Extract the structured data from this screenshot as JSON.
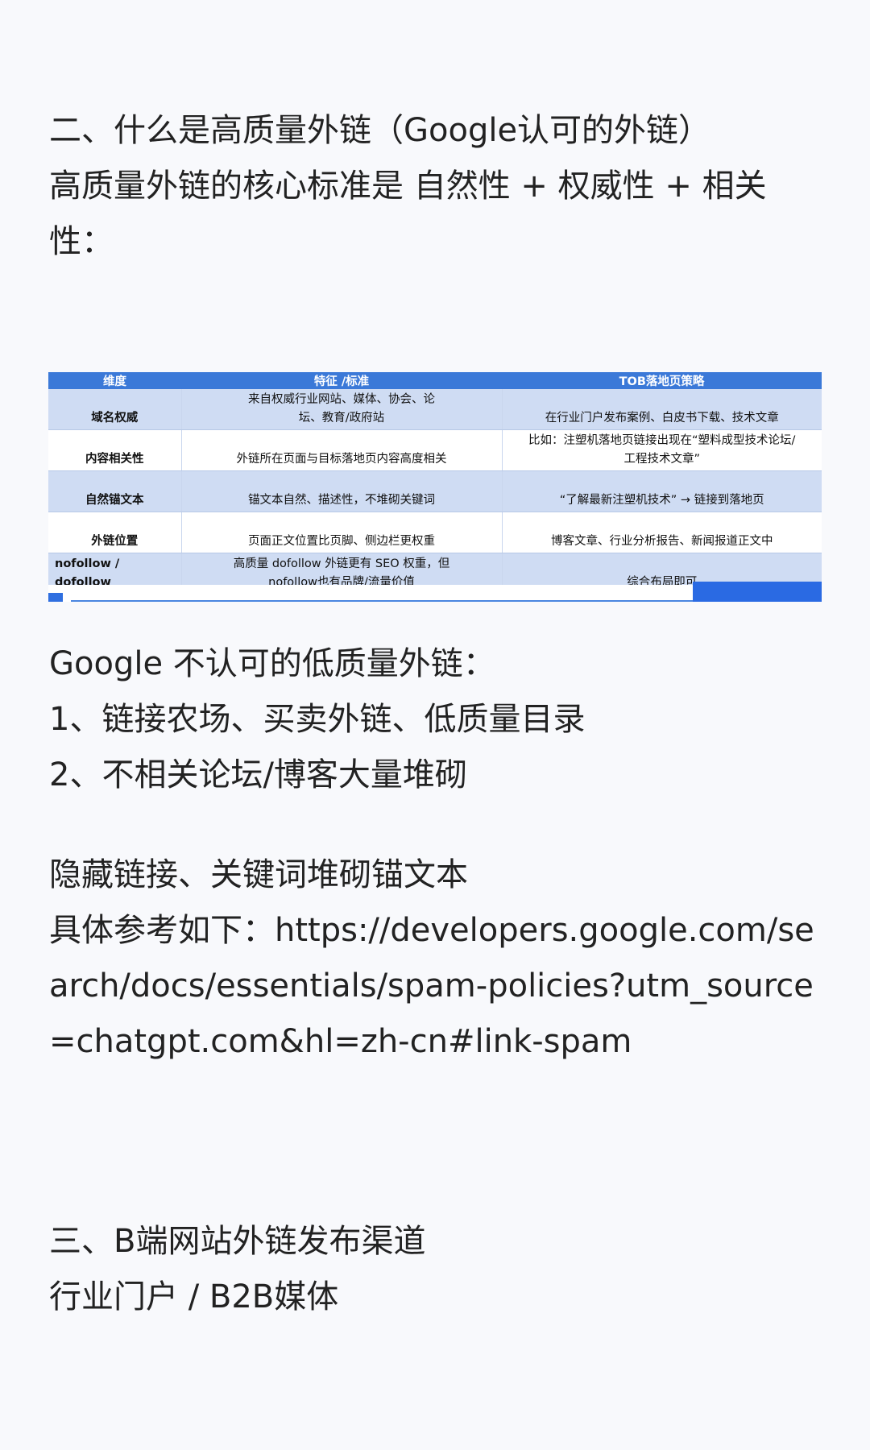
{
  "section2": {
    "heading": "二、什么是高质量外链（Google认可的外链）",
    "core_standard": "高质量外链的核心标准是 自然性 + 权威性 + 相关性："
  },
  "table": {
    "headers": [
      "维度",
      "特征 /标准",
      "TOB落地页策略"
    ],
    "rows": [
      {
        "dimension": "域名权威",
        "feature": "来自权威行业网站、媒体、协会、论坛、教育/政府站",
        "strategy": "在行业门户发布案例、白皮书下载、技术文章"
      },
      {
        "dimension": "内容相关性",
        "feature": "外链所在页面与目标落地页内容高度相关",
        "strategy": "比如：注塑机落地页链接出现在“塑料成型技术论坛/工程技术文章”"
      },
      {
        "dimension": "自然锚文本",
        "feature": "锚文本自然、描述性，不堆砌关键词",
        "strategy": "“了解最新注塑机技术” → 链接到落地页"
      },
      {
        "dimension": "外链位置",
        "feature": "页面正文位置比页脚、侧边栏更权重",
        "strategy": "博客文章、行业分析报告、新闻报道正文中"
      },
      {
        "dimension": "nofollow / dofollow",
        "feature": "高质量 dofollow 外链更有 SEO 权重，但nofollow也有品牌/流量价值",
        "strategy": "综合布局即可"
      }
    ],
    "colors": {
      "header": "#3b79d8",
      "alt_row": "#cfdcf3"
    }
  },
  "low_quality": {
    "title": "Google 不认可的低质量外链：",
    "items": [
      "1、链接农场、买卖外链、低质量目录",
      "2、不相关论坛/博客大量堆砌"
    ],
    "hidden": "隐藏链接、关键词堆砌锚文本",
    "reference": "具体参考如下：https://developers.google.com/search/docs/essentials/spam-policies?utm_source=chatgpt.com&hl=zh-cn#link-spam"
  },
  "section3": {
    "heading": "三、B端网站外链发布渠道",
    "channel": "行业门户 / B2B媒体"
  }
}
